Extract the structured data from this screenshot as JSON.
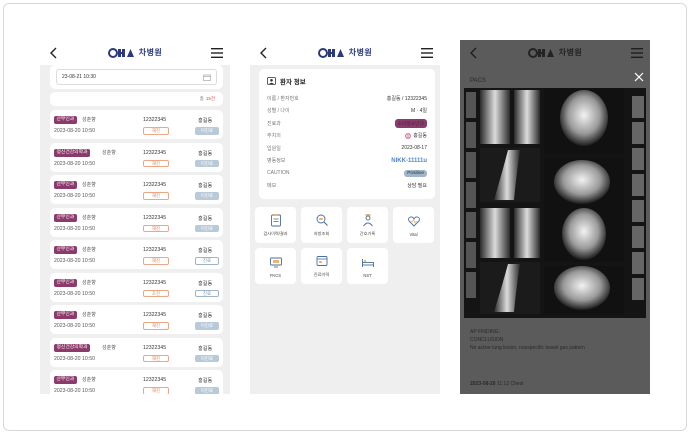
{
  "brand": {
    "name": "차병원"
  },
  "screen1": {
    "date_value": "23-08-21 10:30",
    "count_label": "총",
    "count_value": "15건",
    "rows": [
      {
        "dept": "산부인과",
        "doctor": "성춘향",
        "date": "2023-08-20 10:50",
        "pid": "12322345",
        "type": "재진",
        "name": "홍길동",
        "status": "미진료",
        "status_style": "solid"
      },
      {
        "dept": "정신건강의학과",
        "doctor": "성춘향",
        "date": "2023-08-20 10:50",
        "pid": "12322345",
        "type": "재진",
        "name": "홍길동",
        "status": "미진료",
        "status_style": "solid"
      },
      {
        "dept": "산부인과",
        "doctor": "성춘향",
        "date": "2023-08-20 10:50",
        "pid": "12322345",
        "type": "재진",
        "name": "홍길동",
        "status": "미진료",
        "status_style": "solid"
      },
      {
        "dept": "산부인과",
        "doctor": "성춘향",
        "date": "2023-08-20 10:50",
        "pid": "12322345",
        "type": "재진",
        "name": "홍길동",
        "status": "미진료",
        "status_style": "solid"
      },
      {
        "dept": "산부인과",
        "doctor": "성춘향",
        "date": "2023-08-20 10:50",
        "pid": "12322345",
        "type": "재진",
        "name": "홍길동",
        "status": "진료",
        "status_style": "outline"
      },
      {
        "dept": "산부인과",
        "doctor": "성춘향",
        "date": "2023-08-20 10:50",
        "pid": "12322345",
        "type": "초진",
        "name": "홍길동",
        "status": "진료",
        "status_style": "outline"
      },
      {
        "dept": "산부인과",
        "doctor": "성춘향",
        "date": "2023-08-20 10:50",
        "pid": "12322345",
        "type": "재진",
        "name": "홍길동",
        "status": "미진료",
        "status_style": "solid"
      },
      {
        "dept": "정신건강의학과",
        "doctor": "성춘향",
        "date": "2023-08-20 10:50",
        "pid": "12322345",
        "type": "재진",
        "name": "홍길동",
        "status": "미진료",
        "status_style": "solid"
      },
      {
        "dept": "산부인과",
        "doctor": "성춘향",
        "date": "2023-08-20 10:50",
        "pid": "12322345",
        "type": "재진",
        "name": "홍길동",
        "status": "미진료",
        "status_style": "solid"
      }
    ]
  },
  "screen2": {
    "title": "환자 정보",
    "rows": [
      {
        "label": "이름 / 환자번호",
        "value": "홍길동 / 12322345"
      },
      {
        "label": "성별 / 나이",
        "value": "M · 4일"
      },
      {
        "label": "진료과",
        "value": "소아청소년과"
      },
      {
        "label": "주치의",
        "value": "홍길동"
      },
      {
        "label": "입원일",
        "value": "2023-08-17"
      },
      {
        "label": "병동정보",
        "value": "NIKK-11111u"
      },
      {
        "label": "CAUTION",
        "value": "Positive"
      },
      {
        "label": "메모",
        "value": "상담 필요"
      }
    ],
    "tiles": [
      {
        "label": "검사이력/결과",
        "icon": "clipboard-icon"
      },
      {
        "label": "처방조회",
        "icon": "search-pill-icon"
      },
      {
        "label": "간호기록",
        "icon": "nurse-icon"
      },
      {
        "label": "Vital",
        "icon": "vital-heart-icon"
      },
      {
        "label": "PACS",
        "icon": "monitor-icon"
      },
      {
        "label": "진료이력",
        "icon": "history-icon"
      },
      {
        "label": "NST",
        "icon": "bed-icon"
      }
    ]
  },
  "screen3": {
    "title": "PACS",
    "report_lines": [
      "AP FINDING:",
      "CONCLUSION",
      "No active lung lesion, nonspecific bowel gas pattern"
    ],
    "report_date": "2023-08-20",
    "report_meta": "11:12 Chest"
  }
}
